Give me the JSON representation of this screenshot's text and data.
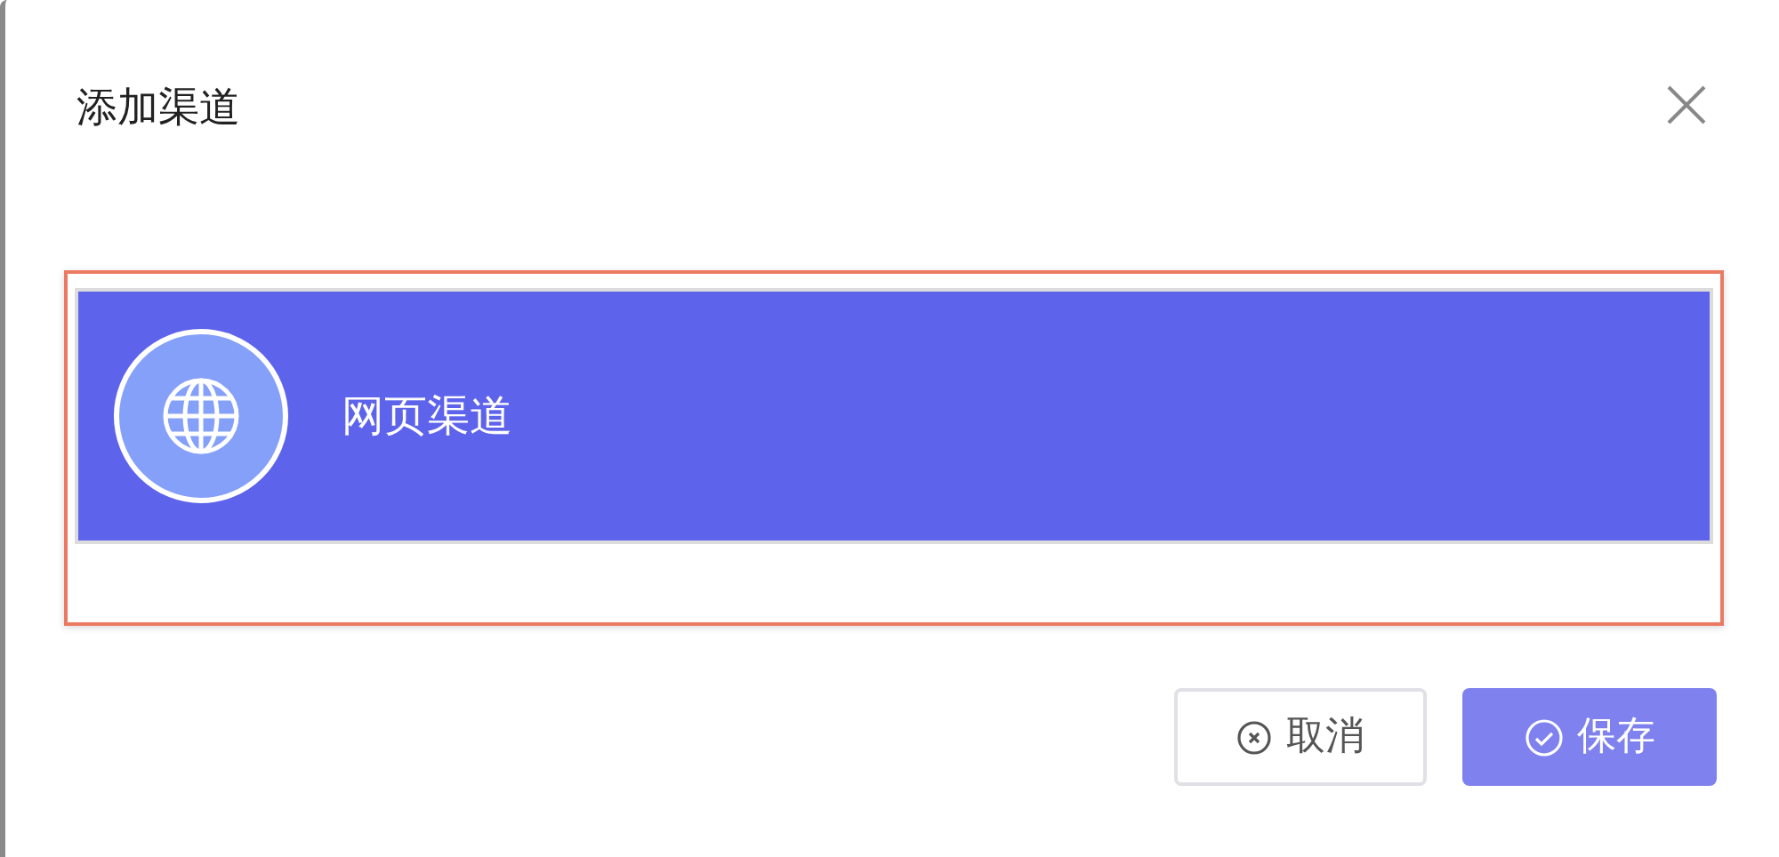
{
  "dialog": {
    "title": "添加渠道"
  },
  "channels": [
    {
      "label": "网页渠道",
      "selected": true
    }
  ],
  "buttons": [
    {
      "kind": "cancel",
      "label": "取消"
    },
    {
      "kind": "save",
      "label": "保存"
    }
  ]
}
